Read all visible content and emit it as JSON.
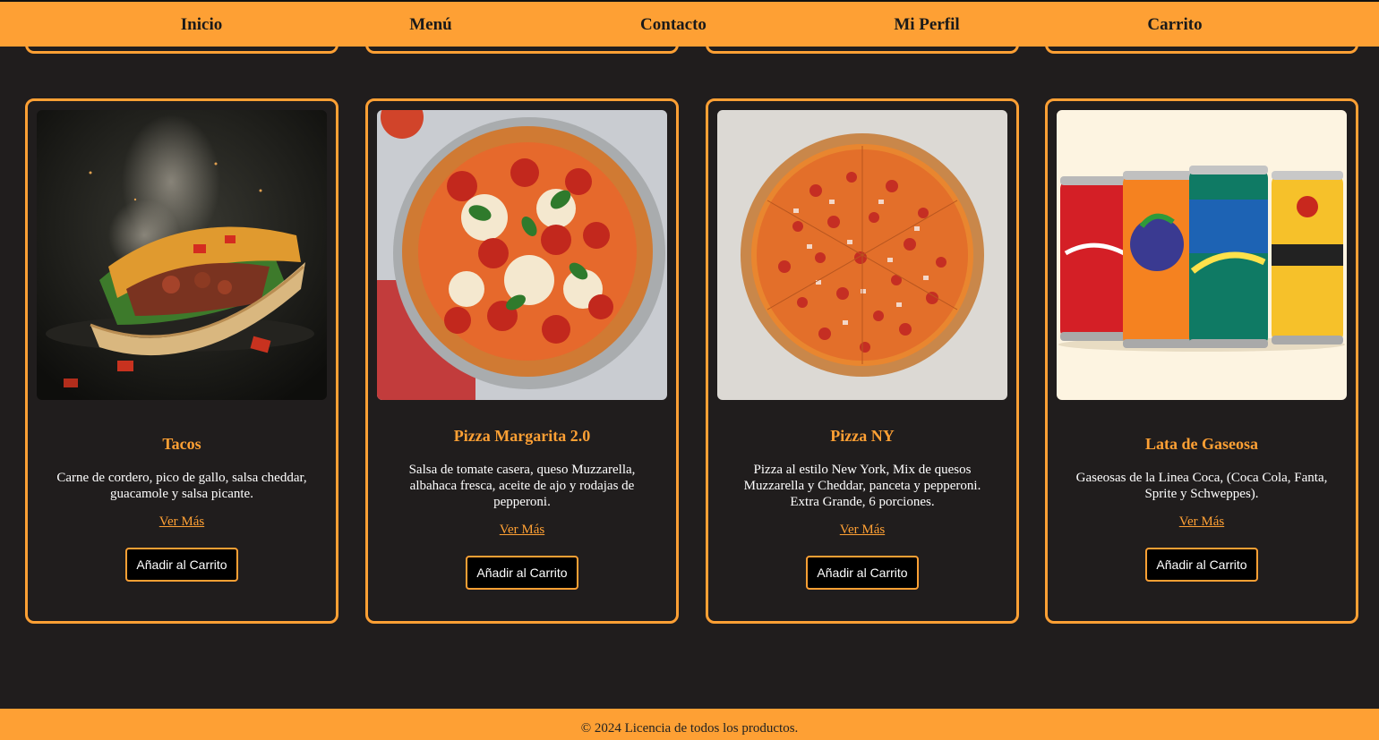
{
  "nav": {
    "items": [
      {
        "label": "Inicio"
      },
      {
        "label": "Menú"
      },
      {
        "label": "Contacto"
      },
      {
        "label": "Mi Perfil"
      },
      {
        "label": "Carrito"
      }
    ]
  },
  "products": [
    {
      "title": "Tacos",
      "description": "Carne de cordero, pico de gallo, salsa cheddar, guacamole y salsa picante.",
      "more_link": "Ver Más",
      "add_button": "Añadir al Carrito",
      "image_icon": "taco-image"
    },
    {
      "title": "Pizza Margarita 2.0",
      "description": "Salsa de tomate casera, queso Muzzarella, albahaca fresca, aceite de ajo y rodajas de pepperoni.",
      "more_link": "Ver Más",
      "add_button": "Añadir al Carrito",
      "image_icon": "pizza-margarita-image"
    },
    {
      "title": "Pizza NY",
      "description": "Pizza al estilo New York, Mix de quesos Muzzarella y Cheddar, panceta y pepperoni. Extra Grande, 6 porciones.",
      "more_link": "Ver Más",
      "add_button": "Añadir al Carrito",
      "image_icon": "pizza-ny-image"
    },
    {
      "title": "Lata de Gaseosa",
      "description": "Gaseosas de la Linea Coca, (Coca Cola, Fanta, Sprite y Schweppes).",
      "more_link": "Ver Más",
      "add_button": "Añadir al Carrito",
      "image_icon": "soda-cans-image"
    }
  ],
  "footer": {
    "text": "© 2024 Licencia de todos los productos."
  },
  "colors": {
    "accent": "#fea034",
    "background": "#201d1d",
    "button_bg": "#000000"
  }
}
